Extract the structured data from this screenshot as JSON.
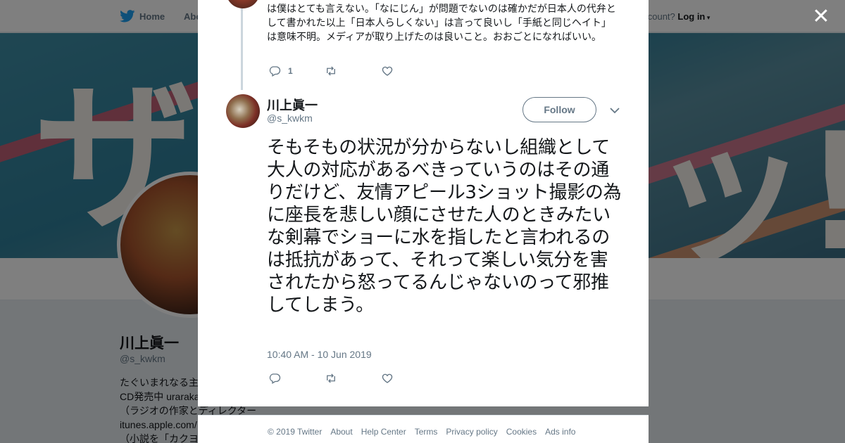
{
  "nav": {
    "home_label": "Home",
    "about_label": "Abo",
    "account_prompt": "account?",
    "login_label": "Log in"
  },
  "banner": {
    "word_left": "ザ",
    "word_right": "ッ!"
  },
  "profile": {
    "name": "川上眞一",
    "handle": "@s_kwkm",
    "bio_lines": [
      "たぐいまれなる主",
      "CD発売中 uraraka",
      "（ラジオの作家とディレクター",
      "itunes.apple.com/",
      "（小説を「カクヨ"
    ]
  },
  "previous_tweet": {
    "text": "は僕はとても言えない。「なにじん」が問題でないのは確かだが日本人の代弁として書かれた以上「日本人らしくない」は言って良いし「手紙と同じヘイト」は意味不明。メディアが取り上げたのは良いこと。おおごとになればいい。",
    "reply_count": "1"
  },
  "tweet": {
    "author_name": "川上眞一",
    "author_handle": "@s_kwkm",
    "follow_label": "Follow",
    "text": "そもそもの状況が分からないし組織として大人の対応があるべきっていうのはその通りだけど、友情アピール3ショット撮影の為に座長を悲しい顔にさせた人のときみたいな剣幕でショーに水を指したと言われるのは抵抗があって、それって楽しい気分を害されたから怒ってるんじゃないのって邪推してしまう。",
    "timestamp": "10:40 AM - 10 Jun 2019"
  },
  "footer": {
    "links": [
      "© 2019 Twitter",
      "About",
      "Help Center",
      "Terms",
      "Privacy policy",
      "Cookies",
      "Ads info"
    ]
  },
  "colors": {
    "accent": "#1da1f2",
    "muted": "#657786",
    "text": "#14171a"
  },
  "icons": [
    "twitter-bird-icon",
    "reply-icon",
    "retweet-icon",
    "like-icon",
    "caret-down-icon",
    "close-icon"
  ]
}
